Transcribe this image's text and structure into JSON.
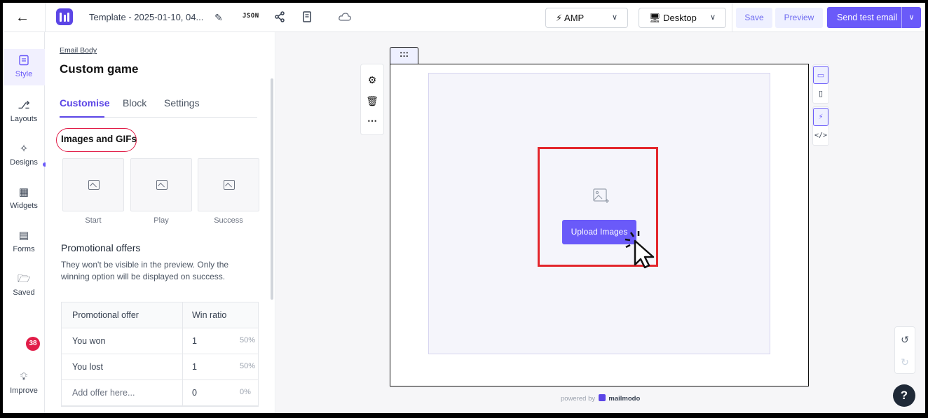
{
  "topbar": {
    "title": "Template - 2025-01-10, 04...",
    "json_label": "JSON",
    "format": {
      "selected": "AMP"
    },
    "device": {
      "selected": "Desktop"
    },
    "save_label": "Save",
    "preview_label": "Preview",
    "send_test_label": "Send test email"
  },
  "rail": {
    "items": [
      {
        "label": "Style",
        "icon": "brush-icon",
        "active": true
      },
      {
        "label": "Layouts",
        "icon": "layouts-icon"
      },
      {
        "label": "Designs",
        "icon": "sparkle-icon"
      },
      {
        "label": "Widgets",
        "icon": "widgets-icon"
      },
      {
        "label": "Forms",
        "icon": "form-icon"
      },
      {
        "label": "Saved",
        "icon": "folder-icon"
      }
    ],
    "improve": {
      "label": "Improve",
      "badge": "38"
    }
  },
  "panel": {
    "breadcrumb": "Email Body",
    "title": "Custom game",
    "tabs": [
      "Customise",
      "Block",
      "Settings"
    ],
    "active_tab": "Customise",
    "images_heading": "Images and GIFs",
    "image_slots": [
      "Start",
      "Play",
      "Success"
    ],
    "promo_heading": "Promotional offers",
    "promo_desc": "They won't be visible in the preview. Only the winning option will be displayed on success.",
    "table": {
      "headers": [
        "Promotional offer",
        "Win ratio"
      ],
      "rows": [
        {
          "offer": "You won",
          "ratio": "1",
          "pct": "50%"
        },
        {
          "offer": "You lost",
          "ratio": "1",
          "pct": "50%"
        }
      ],
      "add_row": {
        "placeholder": "Add offer here...",
        "ratio": "0",
        "pct": "0%"
      }
    }
  },
  "canvas": {
    "handle_label": ":::",
    "upload_label": "Upload Images",
    "powered_by": "powered by",
    "brand": "mailmodo",
    "help_label": "?"
  },
  "colors": {
    "brand": "#6a5af9",
    "highlight": "#e3262c"
  }
}
